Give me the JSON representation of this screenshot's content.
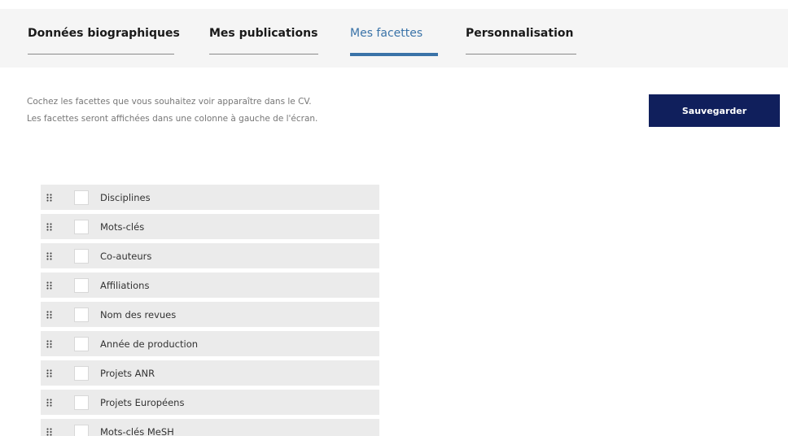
{
  "tabs": [
    {
      "label": "Données biographiques",
      "active": false
    },
    {
      "label": "Mes publications",
      "active": false
    },
    {
      "label": "Mes facettes",
      "active": true
    },
    {
      "label": "Personnalisation",
      "active": false
    }
  ],
  "intro": {
    "line1": "Cochez les facettes que vous souhaitez voir apparaître dans le CV.",
    "line2": "Les facettes seront affichées dans une colonne à gauche de l'écran."
  },
  "save_button": {
    "label": "Sauvegarder"
  },
  "facets": [
    {
      "label": "Disciplines",
      "checked": false
    },
    {
      "label": "Mots-clés",
      "checked": false
    },
    {
      "label": "Co-auteurs",
      "checked": false
    },
    {
      "label": "Affiliations",
      "checked": false
    },
    {
      "label": "Nom des revues",
      "checked": false
    },
    {
      "label": "Année de production",
      "checked": false
    },
    {
      "label": "Projets ANR",
      "checked": false
    },
    {
      "label": "Projets Européens",
      "checked": false
    },
    {
      "label": "Mots-clés MeSH",
      "checked": false
    }
  ],
  "colors": {
    "accent": "#3a73a8",
    "button_bg": "#101f5c",
    "row_bg": "#ebebeb",
    "tabbar_bg": "#f5f5f5"
  },
  "icons": {
    "drag": "drag-handle-icon",
    "checkbox": "checkbox-icon"
  }
}
